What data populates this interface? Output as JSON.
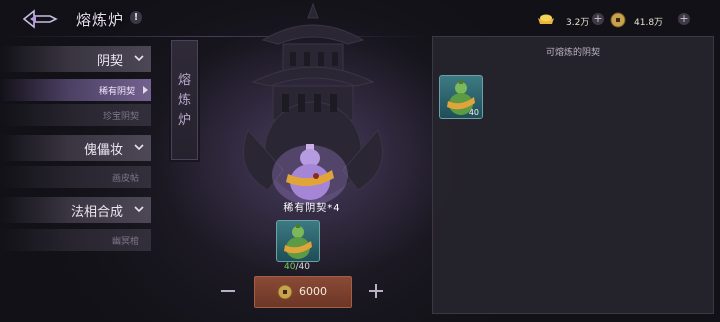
{
  "header": {
    "title": "熔炼炉",
    "info_symbol": "!",
    "gold": {
      "value": "3.2万",
      "icon": "gold-ingot-icon"
    },
    "coin": {
      "value": "41.8万",
      "icon": "copper-coin-icon"
    }
  },
  "menu": {
    "categories": [
      {
        "label": "阴契",
        "icon": "chevron-down-icon",
        "subs": [
          {
            "label": "稀有阴契",
            "active": true
          },
          {
            "label": "珍宝阴契",
            "active": false
          }
        ]
      },
      {
        "label": "傀儡妆",
        "icon": "chevron-down-icon",
        "subs": [
          {
            "label": "画皮帖",
            "active": false
          }
        ]
      },
      {
        "label": "法相合成",
        "icon": "chevron-down-icon",
        "subs": [
          {
            "label": "幽冥棺",
            "active": false
          }
        ]
      }
    ]
  },
  "furnace": {
    "banner": "熔炼炉",
    "main_item": {
      "label": "稀有阴契*4",
      "icon": "purple-gourd-icon"
    },
    "material": {
      "have": "40",
      "need": "40",
      "icon": "green-gourd-icon"
    },
    "craft": {
      "cost": "6000",
      "icon": "copper-coin-icon"
    },
    "minus_label": "−",
    "plus_label": "+"
  },
  "panel": {
    "title": "可熔炼的阴契",
    "items": [
      {
        "count": "40",
        "icon": "green-gourd-icon"
      }
    ]
  },
  "colors": {
    "accent_green": "#6fd25e",
    "craft_button": "#7b3f2e",
    "active_tab": "#6e5a8e"
  }
}
